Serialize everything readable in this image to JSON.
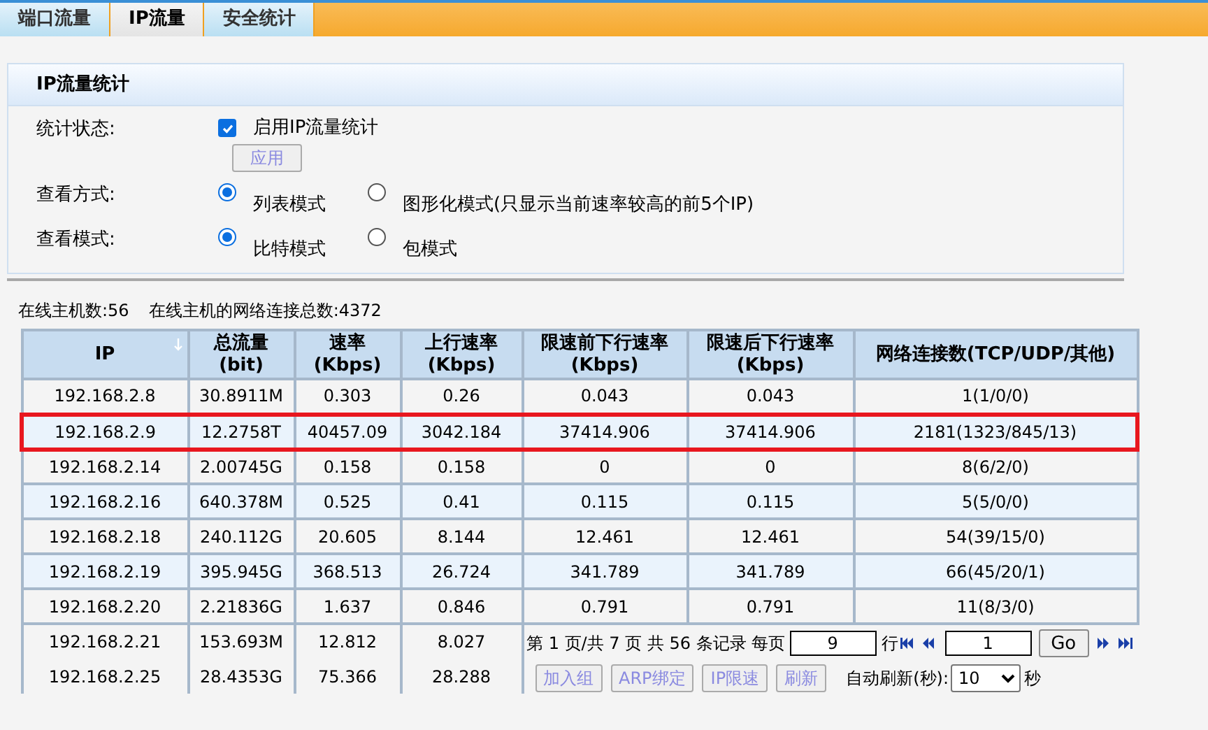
{
  "tabs": [
    {
      "label": "端口流量",
      "selected": false
    },
    {
      "label": "IP流量",
      "selected": true
    },
    {
      "label": "安全统计",
      "selected": false
    }
  ],
  "panel": {
    "title": "IP流量统计",
    "fields": [
      {
        "kind": "checkbox",
        "label": "统计状态:",
        "option": "启用IP流量统计",
        "checked": true,
        "button": {
          "label": "应用",
          "disabled": true
        }
      },
      {
        "kind": "radio",
        "label": "查看方式:",
        "options": [
          {
            "label": "列表模式",
            "selected": true
          },
          {
            "label": "图形化模式(只显示当前速率较高的前5个IP)",
            "selected": false
          }
        ]
      },
      {
        "kind": "radio",
        "label": "查看模式:",
        "options": [
          {
            "label": "比特模式",
            "selected": true
          },
          {
            "label": "包模式",
            "selected": false
          }
        ]
      }
    ]
  },
  "summary": [
    "在线主机数:56",
    "在线主机的网络连接总数:4372"
  ],
  "table": {
    "columns": [
      "IP",
      "总流量\n(bit)",
      "速率\n(Kbps)",
      "上行速率\n(Kbps)",
      "限速前下行速率\n(Kbps)",
      "限速后下行速率\n(Kbps)",
      "网络连接数(TCP/UDP/其他)"
    ],
    "rows": [
      {
        "highlighted": false,
        "cells": [
          "192.168.2.8",
          "30.8911M",
          "0.303",
          "0.26",
          "0.043",
          "0.043",
          "1(1/0/0)"
        ]
      },
      {
        "highlighted": true,
        "cells": [
          "192.168.2.9",
          "12.2758T",
          "40457.09",
          "3042.184",
          "37414.906",
          "37414.906",
          "2181(1323/845/13)"
        ]
      },
      {
        "highlighted": false,
        "cells": [
          "192.168.2.14",
          "2.00745G",
          "0.158",
          "0.158",
          "0",
          "0",
          "8(6/2/0)"
        ]
      },
      {
        "highlighted": false,
        "cells": [
          "192.168.2.16",
          "640.378M",
          "0.525",
          "0.41",
          "0.115",
          "0.115",
          "5(5/0/0)"
        ]
      },
      {
        "highlighted": false,
        "cells": [
          "192.168.2.18",
          "240.112G",
          "20.605",
          "8.144",
          "12.461",
          "12.461",
          "54(39/15/0)"
        ]
      },
      {
        "highlighted": false,
        "cells": [
          "192.168.2.19",
          "395.945G",
          "368.513",
          "26.724",
          "341.789",
          "341.789",
          "66(45/20/1)"
        ]
      },
      {
        "highlighted": false,
        "cells": [
          "192.168.2.20",
          "2.21836G",
          "1.637",
          "0.846",
          "0.791",
          "0.791",
          "11(8/3/0)"
        ]
      },
      {
        "highlighted": false,
        "cells": [
          "192.168.2.21",
          "153.693M",
          "12.812",
          "8.027"
        ]
      },
      {
        "highlighted": false,
        "cells": [
          "192.168.2.25",
          "28.4353G",
          "75.366",
          "28.288"
        ]
      }
    ]
  },
  "pager": {
    "info": "第 1 页/共 7 页 共 56 条记录 每页",
    "per_page": "9",
    "per_page_unit": "行",
    "page": "1",
    "go": "Go",
    "buttons": [
      {
        "label": "加入组",
        "disabled": true
      },
      {
        "label": "ARP绑定",
        "disabled": true
      },
      {
        "label": "IP限速",
        "disabled": true
      },
      {
        "label": "刷新",
        "disabled": true
      }
    ],
    "refresh_label": "自动刷新(秒):",
    "refresh_value": "10",
    "refresh_unit": "秒"
  }
}
